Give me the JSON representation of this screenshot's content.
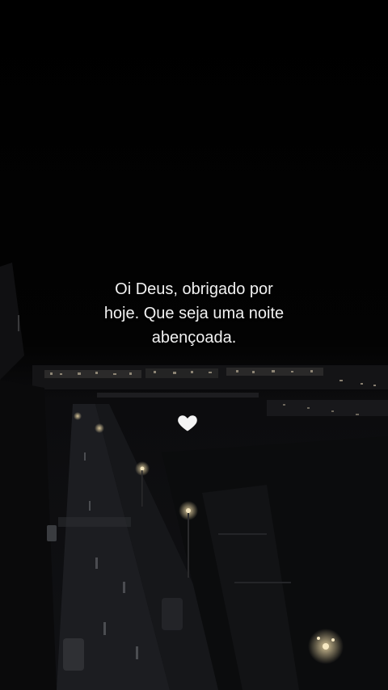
{
  "caption": {
    "line1": "Oi Deus, obrigado por",
    "line2": "hoje. Que seja uma noite",
    "line3": "abençoada."
  },
  "heart": {
    "icon": "white-heart-icon",
    "color": "#f4f4f4"
  },
  "colors": {
    "sky": "#000000",
    "city_lights": "#d7c8a6",
    "road": "#23252a"
  }
}
